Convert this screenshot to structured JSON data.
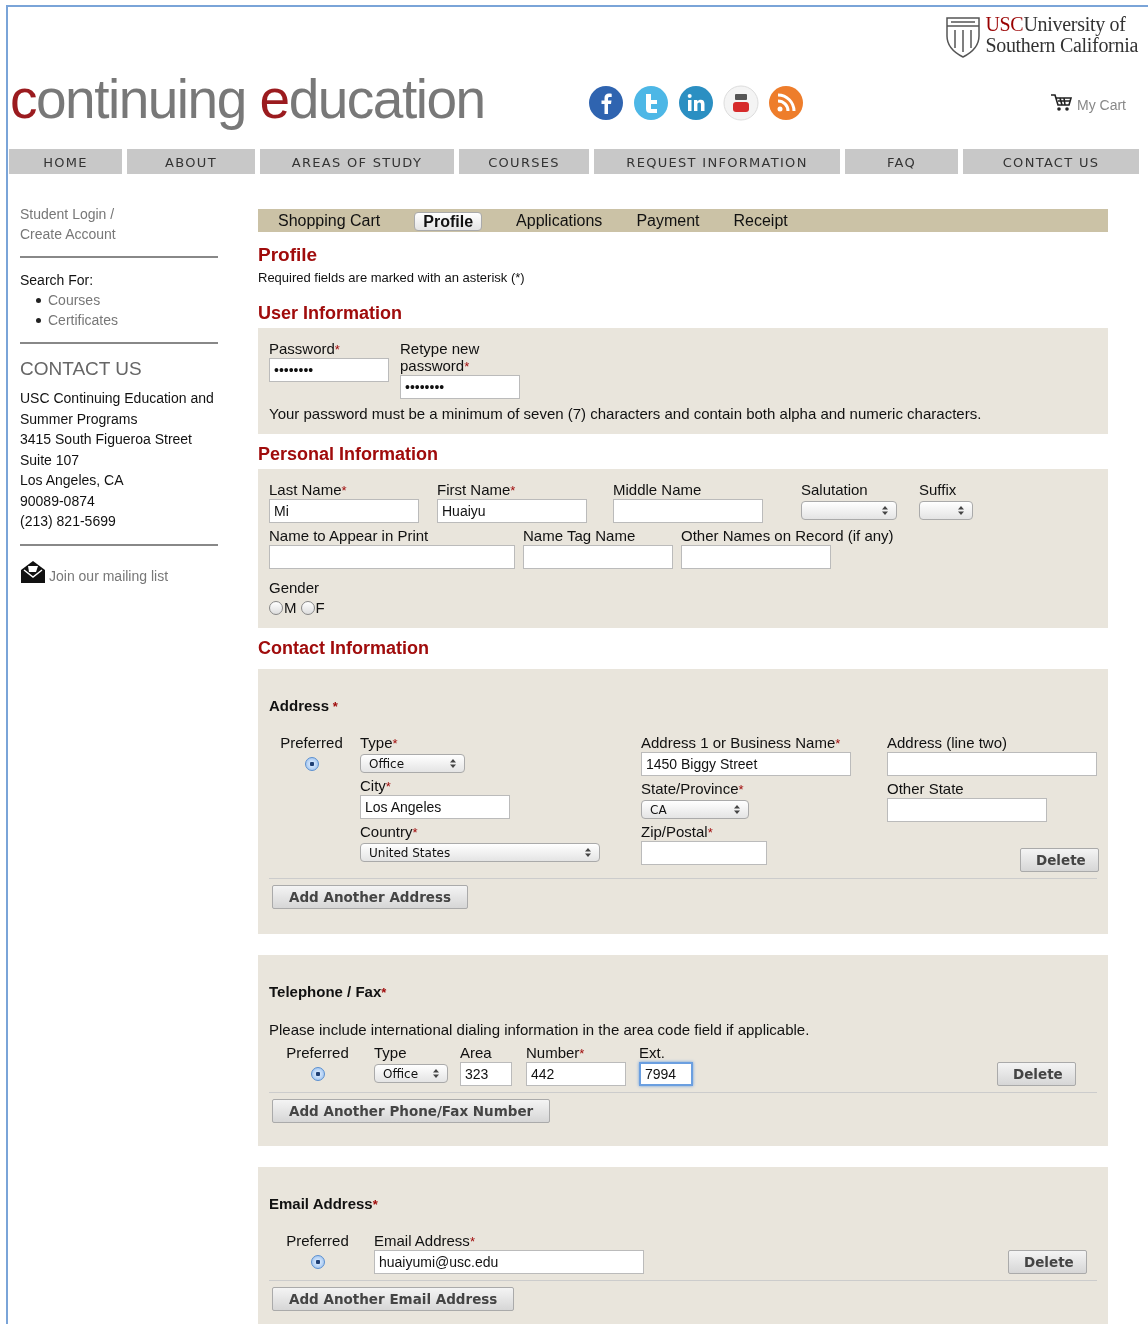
{
  "header": {
    "logo_words": [
      "continuing",
      "education"
    ],
    "university": {
      "abbr": "USC",
      "lines": [
        "University of",
        "Southern California"
      ]
    },
    "cart": "My Cart"
  },
  "nav": [
    "HOME",
    "ABOUT",
    "AREAS OF STUDY",
    "COURSES",
    "REQUEST INFORMATION",
    "FAQ",
    "CONTACT US"
  ],
  "sidebar": {
    "login": "Student Login / Create Account",
    "search_label": "Search For:",
    "search_links": [
      "Courses",
      "Certificates"
    ],
    "contact_title": "CONTACT US",
    "contact_lines": [
      "USC Continuing Education and",
      "Summer Programs",
      "3415 South Figueroa Street",
      "Suite 107",
      "Los Angeles, CA",
      "90089-0874",
      "(213) 821-5699"
    ],
    "mailing": "Join our mailing list"
  },
  "steps": [
    {
      "label": "Shopping Cart",
      "selected": false
    },
    {
      "label": "Profile",
      "selected": true
    },
    {
      "label": "Applications",
      "selected": false
    },
    {
      "label": "Payment",
      "selected": false
    },
    {
      "label": "Receipt",
      "selected": false
    }
  ],
  "page_title": "Profile",
  "required_note": "Required fields are marked with an asterisk (*)",
  "user_info": {
    "title": "User Information",
    "fields": [
      {
        "kind": "text",
        "label": "Password",
        "mark": "*",
        "value": "••••••••"
      },
      {
        "kind": "text",
        "label": "Retype new password",
        "mark": "*",
        "value": "••••••••"
      }
    ],
    "hint": "Your password must be a minimum of seven (7) characters and contain both alpha and numeric characters."
  },
  "personal": {
    "title": "Personal Information",
    "rows": [
      [
        {
          "kind": "text",
          "label": "Last Name",
          "mark": "*",
          "value": "Mi"
        },
        {
          "kind": "text",
          "label": "First Name",
          "mark": "*",
          "value": "Huaiyu"
        },
        {
          "kind": "text",
          "label": "Middle Name"
        },
        {
          "kind": "select",
          "label": "Salutation"
        },
        {
          "kind": "select",
          "label": "Suffix"
        }
      ],
      [
        {
          "kind": "text",
          "label": "Name to Appear in Print"
        },
        {
          "kind": "text",
          "label": "Name Tag Name"
        },
        {
          "kind": "text",
          "label": "Other Names on Record (if any)"
        }
      ]
    ],
    "gender": {
      "label": "Gender",
      "options": [
        {
          "label": "M",
          "selected": false
        },
        {
          "label": "F",
          "selected": false
        }
      ]
    }
  },
  "contact": {
    "title": "Contact Information",
    "address": {
      "title": "Address",
      "mark": "*",
      "preferred_label": "Preferred",
      "preferred": true,
      "columns": [
        [
          {
            "kind": "select",
            "label": "Type",
            "mark": "*",
            "value": "Office"
          },
          {
            "kind": "text",
            "label": "City",
            "mark": "*",
            "value": "Los Angeles"
          },
          {
            "kind": "select",
            "label": "Country",
            "mark": "*",
            "value": "United States"
          }
        ],
        [
          {
            "kind": "text",
            "label": "Address 1 or Business Name",
            "mark": "*",
            "value": "1450 Biggy Street"
          },
          {
            "kind": "select",
            "label": "State/Province",
            "mark": "*",
            "value": "CA"
          },
          {
            "kind": "text",
            "label": "Zip/Postal",
            "mark": "*"
          }
        ],
        [
          {
            "kind": "text",
            "label": "Address (line two)"
          },
          {
            "kind": "text",
            "label": "Other State"
          }
        ]
      ],
      "delete": "Delete",
      "add": "Add Another Address"
    },
    "phone": {
      "title": "Telephone / Fax",
      "mark": "*",
      "note": "Please include international dialing information in the area code field if applicable.",
      "preferred_label": "Preferred",
      "preferred": true,
      "fields": [
        {
          "kind": "select",
          "label": "Type",
          "value": "Office"
        },
        {
          "kind": "text",
          "label": "Area",
          "value": "323"
        },
        {
          "kind": "text",
          "label": "Number",
          "mark": "*",
          "value": "442"
        },
        {
          "kind": "text",
          "label": "Ext.",
          "value": "7994",
          "focused": true
        }
      ],
      "delete": "Delete",
      "add": "Add Another Phone/Fax Number"
    },
    "email": {
      "title": "Email Address",
      "mark": "*",
      "preferred_label": "Preferred",
      "preferred": true,
      "fields": [
        {
          "kind": "text",
          "label": "Email Address",
          "mark": "*",
          "value": "huaiyumi@usc.edu"
        }
      ],
      "delete": "Delete",
      "add": "Add Another Email Address"
    }
  }
}
